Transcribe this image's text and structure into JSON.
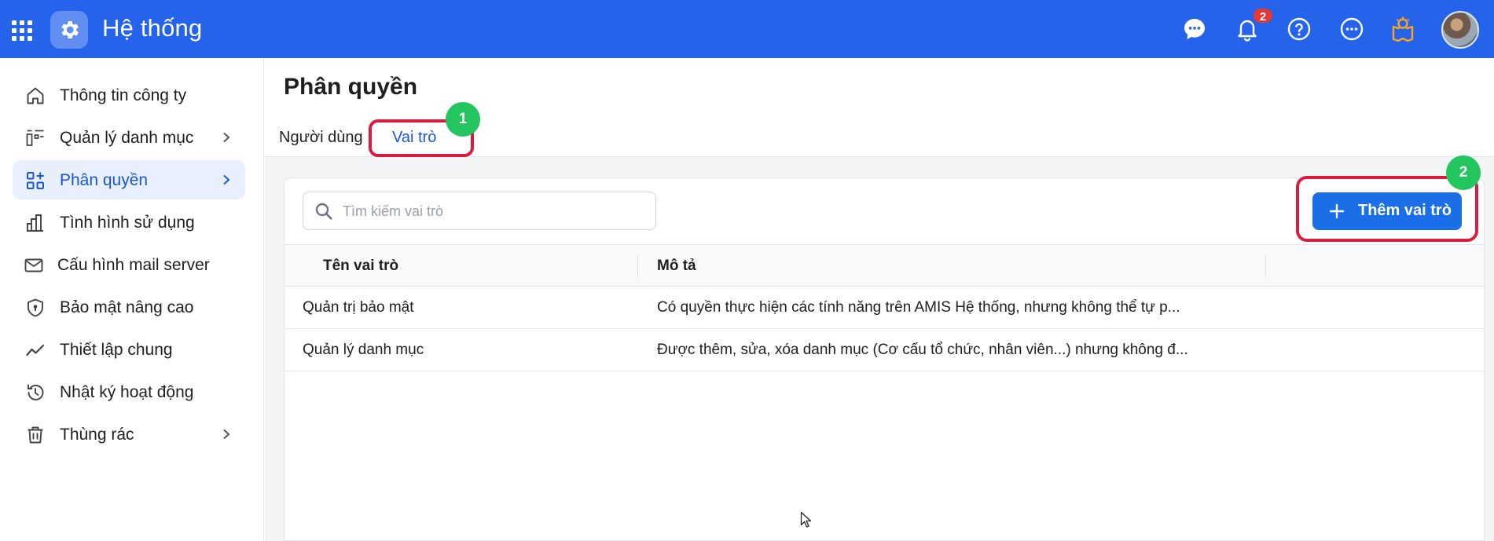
{
  "header": {
    "title": "Hệ thống",
    "notification_count": "2",
    "icons": [
      "apps-grid-icon",
      "settings-gear-icon",
      "chat-icon",
      "bell-icon",
      "help-icon",
      "more-icon",
      "idea-map-icon"
    ]
  },
  "sidebar": {
    "items": [
      {
        "label": "Thông tin công ty",
        "icon": "home-icon",
        "has_submenu": false,
        "active": false
      },
      {
        "label": "Quản lý danh mục",
        "icon": "catalog-icon",
        "has_submenu": true,
        "active": false
      },
      {
        "label": "Phân quyền",
        "icon": "permission-grid-icon",
        "has_submenu": true,
        "active": true
      },
      {
        "label": "Tình hình sử dụng",
        "icon": "bar-chart-icon",
        "has_submenu": false,
        "active": false
      },
      {
        "label": "Cấu hình mail server",
        "icon": "mail-icon",
        "has_submenu": false,
        "active": false
      },
      {
        "label": "Bảo mật nâng cao",
        "icon": "shield-icon",
        "has_submenu": false,
        "active": false
      },
      {
        "label": "Thiết lập chung",
        "icon": "trend-line-icon",
        "has_submenu": false,
        "active": false
      },
      {
        "label": "Nhật ký hoạt động",
        "icon": "history-icon",
        "has_submenu": false,
        "active": false
      },
      {
        "label": "Thùng rác",
        "icon": "trash-icon",
        "has_submenu": true,
        "active": false
      }
    ]
  },
  "main": {
    "title": "Phân quyền",
    "tabs": [
      {
        "label": "Người dùng",
        "active": false
      },
      {
        "label": "Vai trò",
        "active": true
      }
    ],
    "search": {
      "placeholder": "Tìm kiếm vai trò",
      "value": ""
    },
    "add_button_label": "Thêm vai trò",
    "table": {
      "columns": [
        "Tên vai trò",
        "Mô tả"
      ],
      "rows": [
        [
          "Quản trị bảo mật",
          "Có quyền thực hiện các tính năng trên AMIS Hệ thống, nhưng không thể tự p..."
        ],
        [
          "Quản lý danh mục",
          "Được thêm, sửa, xóa danh mục (Cơ cấu tổ chức, nhân viên...) nhưng không đ..."
        ]
      ]
    },
    "annotations": [
      {
        "step": "1",
        "target": "tab-roles"
      },
      {
        "step": "2",
        "target": "add-role-button"
      }
    ]
  },
  "colors": {
    "header_bg": "#2563eb",
    "accent": "#1a6ee8",
    "active_text": "#1a56d6",
    "active_bg": "#e8f0fe",
    "highlight_box": "#d81e3c",
    "step_badge": "#22c55e",
    "notification_badge": "#e53935"
  }
}
